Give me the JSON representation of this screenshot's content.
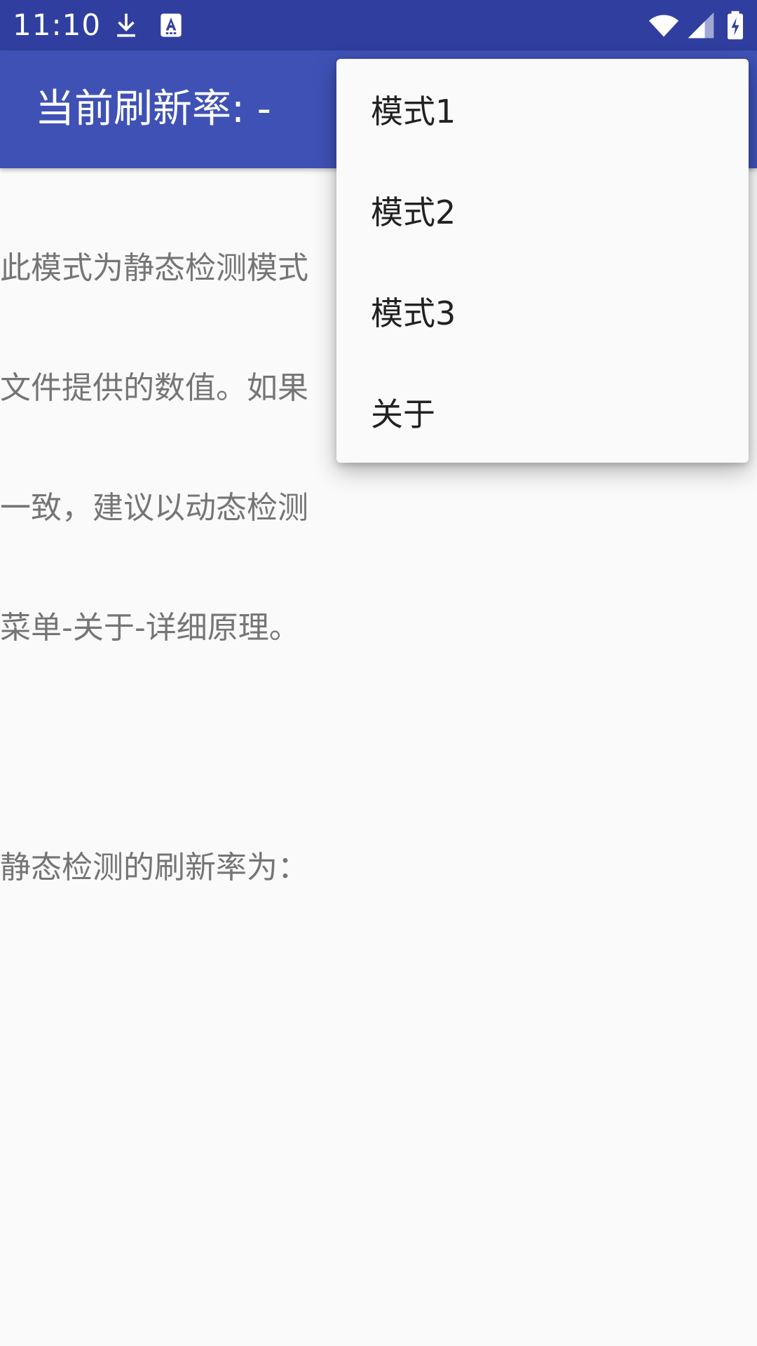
{
  "status_bar": {
    "time": "11:10",
    "icons": [
      "download-icon",
      "keyboard-a-icon",
      "wifi-icon",
      "signal-icon",
      "battery-charging-icon"
    ],
    "background_color": "#303f9f"
  },
  "app_bar": {
    "title": "当前刷新率: -",
    "background_color": "#3f51b5"
  },
  "content": {
    "lines": [
      "此模式为静态检测模式",
      "文件提供的数值。如果",
      "一致，建议以动态检测",
      "菜单-关于-详细原理。",
      "",
      "静态检测的刷新率为："
    ]
  },
  "menu": {
    "items": [
      {
        "label": "模式1"
      },
      {
        "label": "模式2"
      },
      {
        "label": "模式3"
      },
      {
        "label": "关于"
      }
    ]
  }
}
